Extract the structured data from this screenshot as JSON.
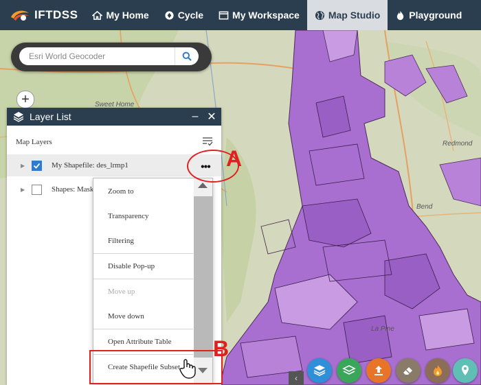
{
  "app": {
    "name": "IFTDSS"
  },
  "nav": {
    "items": [
      {
        "label": "My Home",
        "icon": "home-icon"
      },
      {
        "label": "Cycle",
        "icon": "cycle-icon"
      },
      {
        "label": "My Workspace",
        "icon": "workspace-icon"
      },
      {
        "label": "Map Studio",
        "icon": "globe-icon",
        "active": true
      },
      {
        "label": "Playground",
        "icon": "fire-icon"
      }
    ]
  },
  "geocoder": {
    "placeholder": "Esri World Geocoder"
  },
  "map": {
    "labels": {
      "town1": "Sweet Home",
      "town2": "Redmond",
      "town3": "Bend",
      "town4": "La Pine"
    }
  },
  "layer_list": {
    "title": "Layer List",
    "section": "Map Layers",
    "layers": [
      {
        "label": "My Shapefile: des_lrmp1",
        "checked": true
      },
      {
        "label": "Shapes: Mask",
        "checked": false
      }
    ],
    "menu": {
      "items": [
        {
          "label": "Zoom to"
        },
        {
          "label": "Transparency"
        },
        {
          "label": "Filtering"
        },
        {
          "label": "Disable Pop-up"
        },
        {
          "label": "Move up",
          "disabled": true
        },
        {
          "label": "Move down"
        },
        {
          "label": "Open Attribute Table"
        },
        {
          "label": "Create Shapefile Subset"
        }
      ]
    }
  },
  "annotations": {
    "a": "A",
    "b": "B"
  },
  "colors": {
    "navbar": "#2b3e50",
    "accent": "#e02020",
    "shapes": "#a86fd0"
  },
  "widgets": [
    {
      "icon": "layers-icon",
      "color": "#2f8fd8"
    },
    {
      "icon": "layer-stack-icon",
      "color": "#3aa65a"
    },
    {
      "icon": "upload-icon",
      "color": "#e8742a"
    },
    {
      "icon": "eraser-icon",
      "color": "#8a7a68"
    },
    {
      "icon": "fire-icon",
      "color": "#8c6e58"
    },
    {
      "icon": "pin-icon",
      "color": "#5fbfb5"
    }
  ]
}
